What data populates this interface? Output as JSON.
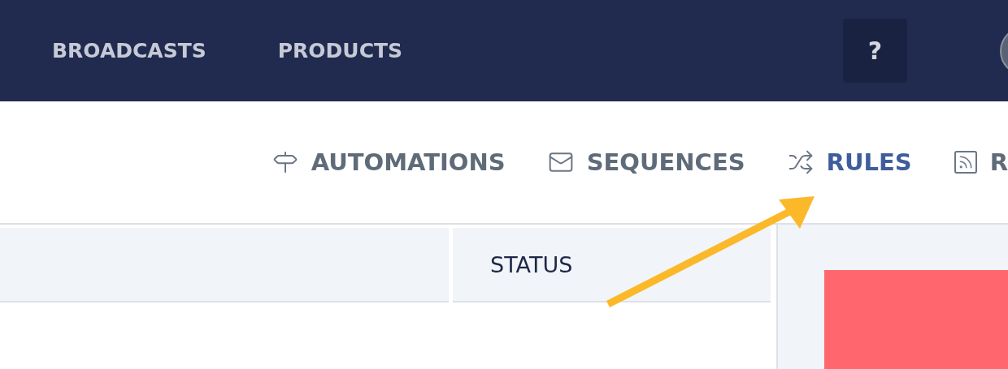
{
  "top_nav": {
    "items": [
      {
        "label": "BROADCASTS"
      },
      {
        "label": "PRODUCTS"
      }
    ],
    "help_button": {
      "label": "?"
    }
  },
  "sub_nav": {
    "tabs": [
      {
        "label": "AUTOMATIONS",
        "kind": "signpost",
        "selected": false
      },
      {
        "label": "SEQUENCES",
        "kind": "envelope",
        "selected": false
      },
      {
        "label": "RULES",
        "kind": "shuffle",
        "selected": true
      },
      {
        "label": "R",
        "kind": "rss",
        "selected": false
      }
    ]
  },
  "table": {
    "columns": [
      {
        "label": "STATUS"
      }
    ]
  },
  "side_panel": {
    "block": {
      "color": "#ff666e"
    }
  }
}
